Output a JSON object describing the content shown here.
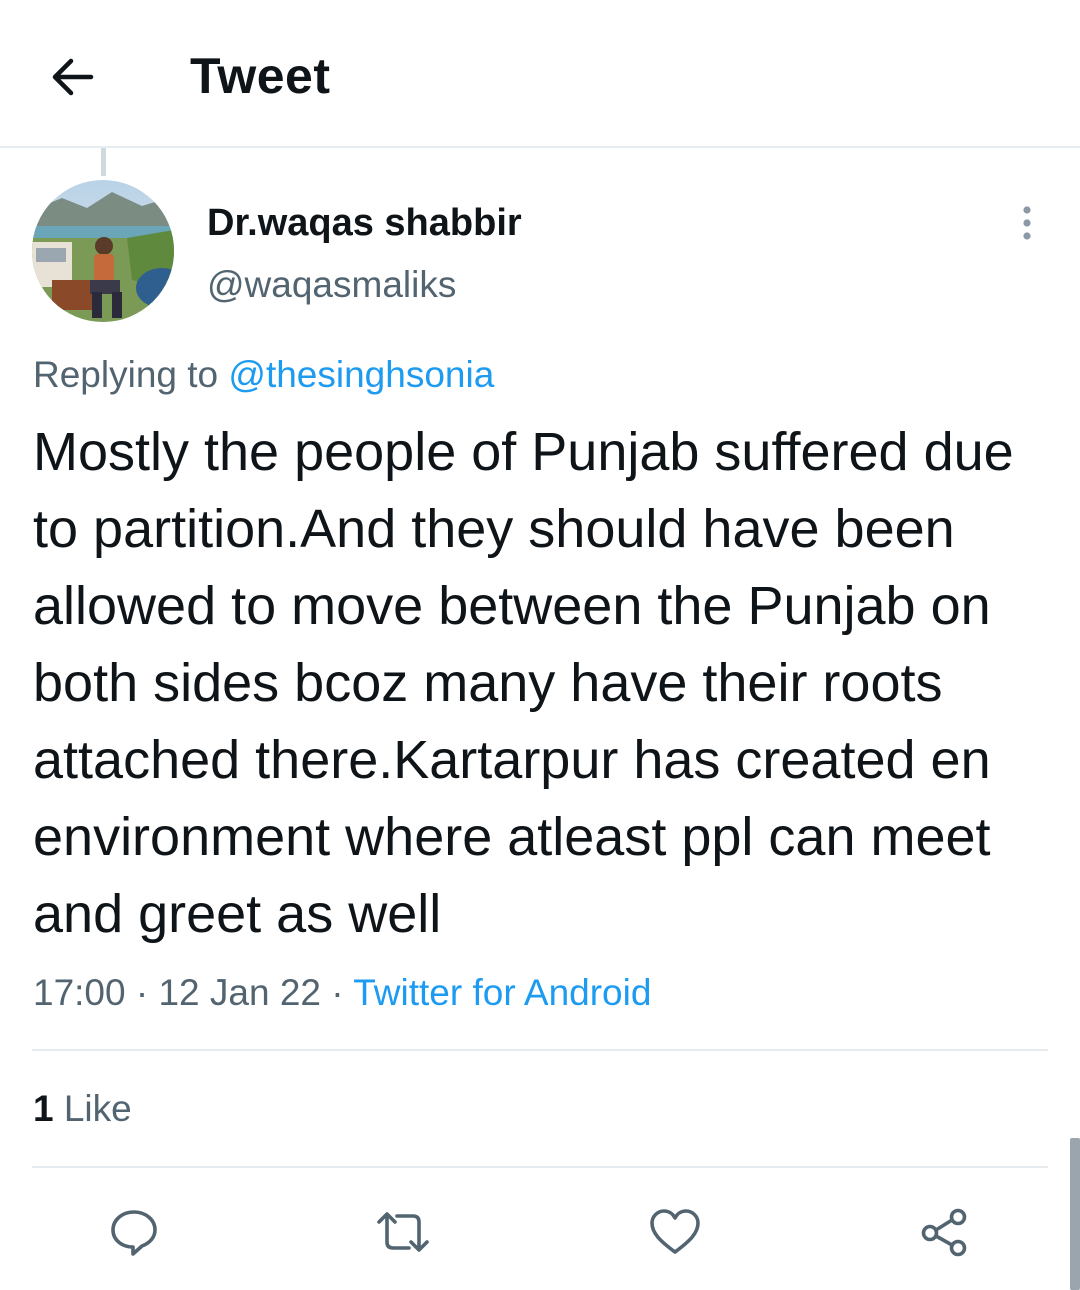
{
  "header": {
    "title": "Tweet",
    "back_icon": "arrow-left-icon"
  },
  "tweet": {
    "author": {
      "display_name": "Dr.waqas shabbir",
      "handle": "@waqasmaliks"
    },
    "replying_to": {
      "prefix": "Replying to",
      "mention": "@thesinghsonia"
    },
    "text": "Mostly the people of Punjab suffered due to partition.And they should have been allowed to move between the Punjab on both sides bcoz many have their roots attached there.Kartarpur has created en environment where atleast ppl can meet and greet as well",
    "time": "17:00",
    "separator": "·",
    "date": "12 Jan 22",
    "source": "Twitter for Android",
    "likes": {
      "count": "1",
      "label": "Like"
    }
  },
  "actions": {
    "reply_icon": "reply-bubble-icon",
    "retweet_icon": "retweet-icon",
    "like_icon": "heart-icon",
    "share_icon": "share-icon"
  },
  "colors": {
    "text_primary": "#0f1419",
    "text_secondary": "#536471",
    "link": "#1d9bf0",
    "divider": "#e6ecf0"
  }
}
